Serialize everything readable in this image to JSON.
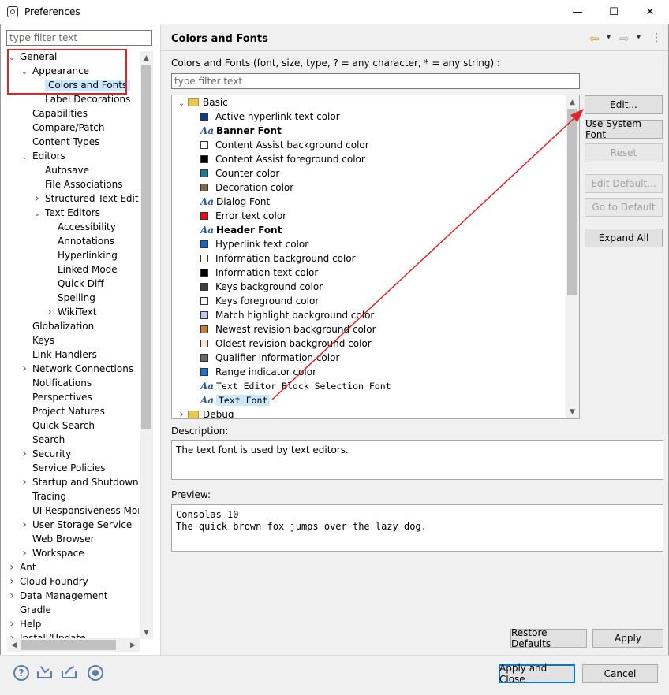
{
  "window": {
    "title": "Preferences",
    "minimize": "—",
    "maximize": "☐",
    "close": "✕"
  },
  "filter": {
    "placeholder": "type filter text"
  },
  "tree": [
    {
      "label": "General",
      "level": 0,
      "chev": "v"
    },
    {
      "label": "Appearance",
      "level": 1,
      "chev": "v"
    },
    {
      "label": "Colors and Fonts",
      "level": 2,
      "chev": "",
      "selected": true
    },
    {
      "label": "Label Decorations",
      "level": 2,
      "chev": ""
    },
    {
      "label": "Capabilities",
      "level": 1,
      "chev": ""
    },
    {
      "label": "Compare/Patch",
      "level": 1,
      "chev": ""
    },
    {
      "label": "Content Types",
      "level": 1,
      "chev": ""
    },
    {
      "label": "Editors",
      "level": 1,
      "chev": "v"
    },
    {
      "label": "Autosave",
      "level": 2,
      "chev": ""
    },
    {
      "label": "File Associations",
      "level": 2,
      "chev": ""
    },
    {
      "label": "Structured Text Editors",
      "level": 2,
      "chev": ">"
    },
    {
      "label": "Text Editors",
      "level": 2,
      "chev": "v"
    },
    {
      "label": "Accessibility",
      "level": 3,
      "chev": ""
    },
    {
      "label": "Annotations",
      "level": 3,
      "chev": ""
    },
    {
      "label": "Hyperlinking",
      "level": 3,
      "chev": ""
    },
    {
      "label": "Linked Mode",
      "level": 3,
      "chev": ""
    },
    {
      "label": "Quick Diff",
      "level": 3,
      "chev": ""
    },
    {
      "label": "Spelling",
      "level": 3,
      "chev": ""
    },
    {
      "label": "WikiText",
      "level": 3,
      "chev": ">"
    },
    {
      "label": "Globalization",
      "level": 1,
      "chev": ""
    },
    {
      "label": "Keys",
      "level": 1,
      "chev": ""
    },
    {
      "label": "Link Handlers",
      "level": 1,
      "chev": ""
    },
    {
      "label": "Network Connections",
      "level": 1,
      "chev": ">"
    },
    {
      "label": "Notifications",
      "level": 1,
      "chev": ""
    },
    {
      "label": "Perspectives",
      "level": 1,
      "chev": ""
    },
    {
      "label": "Project Natures",
      "level": 1,
      "chev": ""
    },
    {
      "label": "Quick Search",
      "level": 1,
      "chev": ""
    },
    {
      "label": "Search",
      "level": 1,
      "chev": ""
    },
    {
      "label": "Security",
      "level": 1,
      "chev": ">"
    },
    {
      "label": "Service Policies",
      "level": 1,
      "chev": ""
    },
    {
      "label": "Startup and Shutdown",
      "level": 1,
      "chev": ">"
    },
    {
      "label": "Tracing",
      "level": 1,
      "chev": ""
    },
    {
      "label": "UI Responsiveness Monitoring",
      "level": 1,
      "chev": ""
    },
    {
      "label": "User Storage Service",
      "level": 1,
      "chev": ">"
    },
    {
      "label": "Web Browser",
      "level": 1,
      "chev": ""
    },
    {
      "label": "Workspace",
      "level": 1,
      "chev": ">"
    },
    {
      "label": "Ant",
      "level": 0,
      "chev": ">"
    },
    {
      "label": "Cloud Foundry",
      "level": 0,
      "chev": ">"
    },
    {
      "label": "Data Management",
      "level": 0,
      "chev": ">"
    },
    {
      "label": "Gradle",
      "level": 0,
      "chev": ""
    },
    {
      "label": "Help",
      "level": 0,
      "chev": ">"
    },
    {
      "label": "Install/Update",
      "level": 0,
      "chev": ">"
    }
  ],
  "page": {
    "title": "Colors and Fonts",
    "description_label": "Colors and Fonts (font, size, type, ? = any character, * = any string) :",
    "filter_placeholder": "type filter text",
    "nav": {
      "back": "⇦",
      "forward": "⇨",
      "dropdown": "▾",
      "menu": "⋮"
    }
  },
  "colors_list": [
    {
      "label": "Basic",
      "kind": "folder",
      "chev": "v"
    },
    {
      "label": "Active hyperlink text color",
      "kind": "color",
      "color": "#0b3e91"
    },
    {
      "label": "Banner Font",
      "kind": "font",
      "bold": true
    },
    {
      "label": "Content Assist background color",
      "kind": "color",
      "color": "#ffffff"
    },
    {
      "label": "Content Assist foreground color",
      "kind": "color",
      "color": "#000000"
    },
    {
      "label": "Counter color",
      "kind": "color",
      "color": "#17808e"
    },
    {
      "label": "Decoration color",
      "kind": "color",
      "color": "#806c44"
    },
    {
      "label": "Dialog Font",
      "kind": "font"
    },
    {
      "label": "Error text color",
      "kind": "color",
      "color": "#e81010"
    },
    {
      "label": "Header Font",
      "kind": "font",
      "bold": true
    },
    {
      "label": "Hyperlink text color",
      "kind": "color",
      "color": "#1466c8"
    },
    {
      "label": "Information background color",
      "kind": "color",
      "color": "#fbfbee"
    },
    {
      "label": "Information text color",
      "kind": "color",
      "color": "#000000"
    },
    {
      "label": "Keys background color",
      "kind": "color",
      "color": "#3d3d3d"
    },
    {
      "label": "Keys foreground color",
      "kind": "color",
      "color": "#ffffff"
    },
    {
      "label": "Match highlight background color",
      "kind": "color",
      "color": "#c4c4f0"
    },
    {
      "label": "Newest revision background color",
      "kind": "color",
      "color": "#c48038"
    },
    {
      "label": "Oldest revision background color",
      "kind": "color",
      "color": "#f7e4d4"
    },
    {
      "label": "Qualifier information color",
      "kind": "color",
      "color": "#6a6a6a"
    },
    {
      "label": "Range indicator color",
      "kind": "color",
      "color": "#1e6fd4"
    },
    {
      "label": "Text Editor Block Selection Font",
      "kind": "font",
      "mono": true
    },
    {
      "label": "Text Font",
      "kind": "font",
      "mono": true,
      "selected": true
    },
    {
      "label": "Debug",
      "kind": "folder",
      "chev": ">"
    }
  ],
  "buttons": {
    "edit": "Edit...",
    "use_system_font": "Use System Font",
    "reset": "Reset",
    "edit_default": "Edit Default...",
    "go_to_default": "Go to Default",
    "expand_all": "Expand All",
    "restore_defaults": "Restore Defaults",
    "apply": "Apply",
    "apply_and_close": "Apply and Close",
    "cancel": "Cancel"
  },
  "description": {
    "label": "Description:",
    "text": "The text font is used by text editors."
  },
  "preview": {
    "label": "Preview:",
    "line1": "Consolas 10",
    "line2": "The quick brown fox jumps over the lazy dog."
  },
  "bottom_icons": [
    "help-icon",
    "import-icon",
    "export-icon",
    "record-icon"
  ],
  "accent": {
    "annotation_red": "#e2232a",
    "selection_blue": "#cce8ff",
    "default_button_border": "#0078d7"
  }
}
